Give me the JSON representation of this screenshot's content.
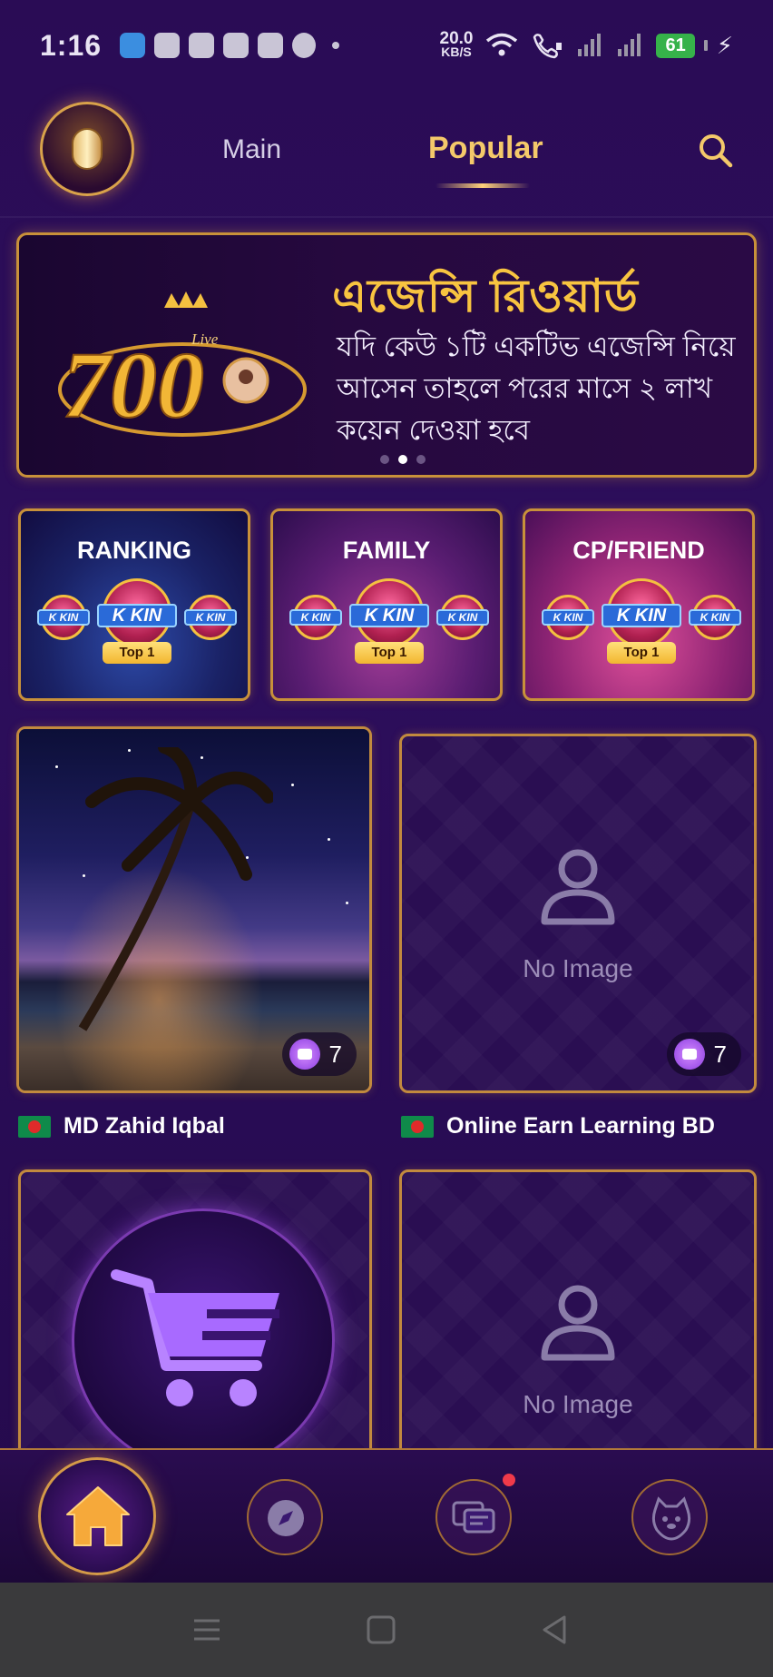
{
  "status_bar": {
    "time": "1:16",
    "net_speed_value": "20.0",
    "net_speed_unit": "KB/S",
    "battery": "61"
  },
  "header": {
    "tabs": [
      {
        "label": "Main",
        "active": false
      },
      {
        "label": "Popular",
        "active": true
      }
    ],
    "accent_color": "#f4c96a"
  },
  "banner": {
    "badge_number": "700",
    "badge_tag": "Live",
    "title": "এজেন্সি রিওয়ার্ড",
    "text": "যদি কেউ ১টি একটিভ এজেন্সি নিয়ে আসেন তাহলে পরের মাসে ২ লাখ কয়েন দেওয়া হবে",
    "page_count": 3,
    "active_page": 2
  },
  "categories": [
    {
      "title": "RANKING",
      "badge_text": "K KIN",
      "rank_label": "Top 1"
    },
    {
      "title": "FAMILY",
      "badge_text": "K KIN",
      "rank_label": "Top 1"
    },
    {
      "title": "CP/FRIEND",
      "badge_text": "K KIN",
      "rank_label": "Top 1"
    }
  ],
  "rooms": [
    {
      "owner": "MD Zahid Iqbal",
      "count": "7",
      "has_image": true
    },
    {
      "owner": "Online Earn Learning BD",
      "count": "7",
      "has_image": false,
      "placeholder": "No Image"
    },
    {
      "owner": "",
      "has_image": true
    },
    {
      "owner": "",
      "has_image": false,
      "placeholder": "No Image"
    }
  ],
  "bottom_nav": {
    "items": [
      "home-icon",
      "compass-icon",
      "chat-icon",
      "profile-icon"
    ],
    "active": "home-icon",
    "has_unread_messages": true
  }
}
